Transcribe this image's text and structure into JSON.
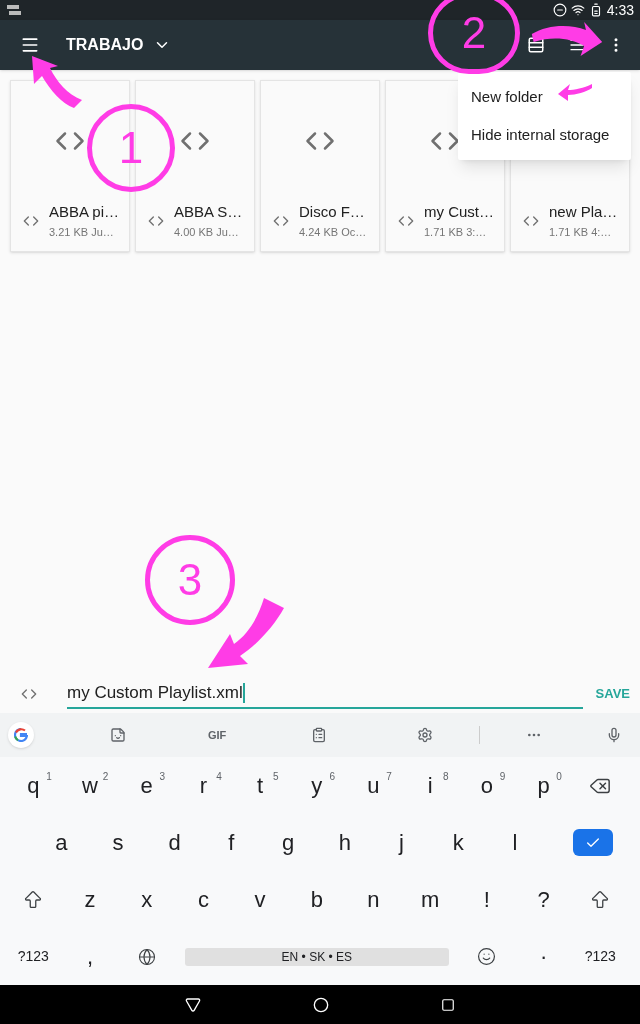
{
  "status_bar": {
    "time": "4:33"
  },
  "toolbar": {
    "title": "TRABAJO"
  },
  "files": [
    {
      "name": "ABBA pi…",
      "meta": "3.21 KB Ju…",
      "preview_icon": true
    },
    {
      "name": "ABBA S…",
      "meta": "4.00 KB Ju…",
      "preview_icon": true
    },
    {
      "name": "Disco F…",
      "meta": "4.24 KB Oc…",
      "preview_icon": true
    },
    {
      "name": "my Cust…",
      "meta": "1.71 KB 3:…",
      "preview_icon": true
    },
    {
      "name": "new Pla…",
      "meta": "1.71 KB 4:…"
    }
  ],
  "menu": {
    "items": [
      {
        "label": "New folder"
      },
      {
        "label": "Hide internal storage"
      }
    ]
  },
  "annotations": [
    {
      "label": "1"
    },
    {
      "label": "2"
    },
    {
      "label": "3"
    }
  ],
  "save_bar": {
    "value": "my Custom Playlist.xml",
    "action": "SAVE"
  },
  "keyboard": {
    "toolbar_gif": "GIF",
    "letter_rows": [
      [
        {
          "kind": "char",
          "label": "q",
          "hint": "1"
        },
        {
          "kind": "char",
          "label": "w",
          "hint": "2"
        },
        {
          "kind": "char",
          "label": "e",
          "hint": "3"
        },
        {
          "kind": "char",
          "label": "r",
          "hint": "4"
        },
        {
          "kind": "char",
          "label": "t",
          "hint": "5"
        },
        {
          "kind": "char",
          "label": "y",
          "hint": "6"
        },
        {
          "kind": "char",
          "label": "u",
          "hint": "7"
        },
        {
          "kind": "char",
          "label": "i",
          "hint": "8"
        },
        {
          "kind": "char",
          "label": "o",
          "hint": "9"
        },
        {
          "kind": "char",
          "label": "p",
          "hint": "0"
        },
        {
          "kind": "backspace"
        }
      ],
      [
        {
          "kind": "spacer"
        },
        {
          "kind": "char",
          "label": "a"
        },
        {
          "kind": "char",
          "label": "s"
        },
        {
          "kind": "char",
          "label": "d"
        },
        {
          "kind": "char",
          "label": "f"
        },
        {
          "kind": "char",
          "label": "g"
        },
        {
          "kind": "char",
          "label": "h"
        },
        {
          "kind": "char",
          "label": "j"
        },
        {
          "kind": "char",
          "label": "k"
        },
        {
          "kind": "char",
          "label": "l"
        },
        {
          "kind": "enter"
        }
      ],
      [
        {
          "kind": "shift"
        },
        {
          "kind": "char",
          "label": "z"
        },
        {
          "kind": "char",
          "label": "x"
        },
        {
          "kind": "char",
          "label": "c"
        },
        {
          "kind": "char",
          "label": "v"
        },
        {
          "kind": "char",
          "label": "b"
        },
        {
          "kind": "char",
          "label": "n"
        },
        {
          "kind": "char",
          "label": "m"
        },
        {
          "kind": "char",
          "label": "!"
        },
        {
          "kind": "char",
          "label": "?"
        },
        {
          "kind": "shift"
        }
      ]
    ],
    "bottom_row": {
      "left": [
        {
          "kind": "small",
          "label": "?123"
        },
        {
          "kind": "char",
          "label": ","
        },
        {
          "kind": "globe"
        }
      ],
      "space": {
        "kind": "space",
        "label": "EN • SK • ES"
      },
      "right": [
        {
          "kind": "emoji"
        },
        {
          "kind": "char",
          "label": "·"
        },
        {
          "kind": "small",
          "label": "?123"
        }
      ]
    }
  }
}
